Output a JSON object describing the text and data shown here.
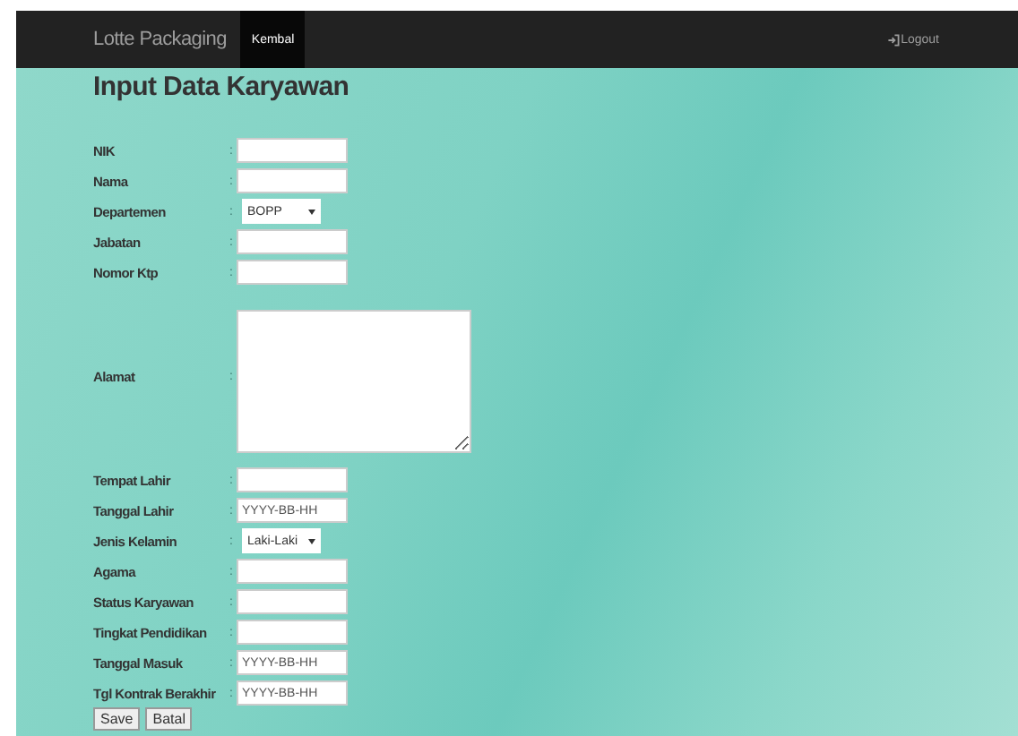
{
  "navbar": {
    "brand": "Lotte Packaging",
    "items": [
      {
        "label": "Kembal",
        "selected": true
      }
    ],
    "logout": "Logout"
  },
  "title": "Input Data Karyawan",
  "form": {
    "separator": ":",
    "fields": [
      {
        "label": "NIK",
        "kind": "text"
      },
      {
        "label": "Nama",
        "kind": "text"
      },
      {
        "label": "Departemen",
        "kind": "select",
        "value": "BOPP"
      },
      {
        "label": "Jabatan",
        "kind": "text"
      },
      {
        "label": "Nomor Ktp",
        "kind": "text"
      },
      {
        "label": "Alamat",
        "kind": "textarea"
      },
      {
        "label": "Tempat Lahir",
        "kind": "text"
      },
      {
        "label": "Tanggal Lahir",
        "kind": "text",
        "placeholder": "YYYY-BB-HH"
      },
      {
        "label": "Jenis Kelamin",
        "kind": "select",
        "value": "Laki-Laki"
      },
      {
        "label": "Agama",
        "kind": "text"
      },
      {
        "label": "Status Karyawan",
        "kind": "text"
      },
      {
        "label": "Tingkat Pendidikan",
        "kind": "text"
      },
      {
        "label": "Tanggal Masuk",
        "kind": "text",
        "placeholder": "YYYY-BB-HH"
      },
      {
        "label": "Tgl Kontrak Berakhir",
        "kind": "text",
        "placeholder": "YYYY-BB-HH"
      }
    ]
  },
  "buttons": [
    "Save",
    "Batal"
  ]
}
